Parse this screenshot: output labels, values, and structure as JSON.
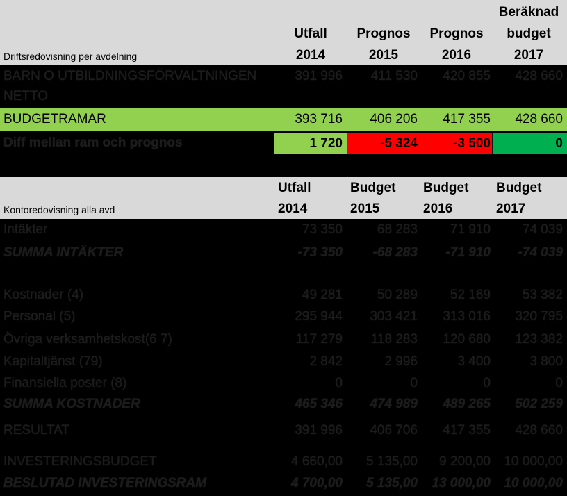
{
  "section1": {
    "caption": "Driftsredovisning per avdelning",
    "headers": [
      {
        "line1": "",
        "line2": "Utfall",
        "line3": "2014"
      },
      {
        "line1": "",
        "line2": "Prognos",
        "line3": "2015"
      },
      {
        "line1": "",
        "line2": "Prognos",
        "line3": "2016"
      },
      {
        "line1": "Beräknad",
        "line2": "budget",
        "line3": "2017"
      }
    ],
    "net_row": {
      "label_line1": "BARN O UTBILDNINGSFÖRVALTNINGEN",
      "label_line2": "NETTO",
      "values": [
        "391 996",
        "411 530",
        "420 855",
        "428 660"
      ]
    },
    "budget_row": {
      "label": "BUDGETRAMAR",
      "values": [
        "393 716",
        "406 206",
        "417 355",
        "428 660"
      ]
    },
    "diff_row": {
      "label": "Diff mellan ram och prognos",
      "values": [
        "1 720",
        "-5 324",
        "-3 500",
        "0"
      ]
    }
  },
  "section2": {
    "caption": "Kontoredovisning alla avd",
    "headers": [
      {
        "line1": "Utfall",
        "line2": "2014"
      },
      {
        "line1": "Budget",
        "line2": "2015"
      },
      {
        "line1": "Budget",
        "line2": "2016"
      },
      {
        "line1": "Budget",
        "line2": "2017"
      }
    ],
    "rows": [
      {
        "label": "Intäkter",
        "values": [
          "73 350",
          "68 283",
          "71 910",
          "74 039"
        ]
      },
      {
        "label": "SUMMA INTÄKTER",
        "values": [
          "-73 350",
          "-68 283",
          "-71 910",
          "-74 039"
        ]
      },
      {
        "label": "Kostnader (4)",
        "values": [
          "49 281",
          "50 289",
          "52 169",
          "53 382"
        ]
      },
      {
        "label": "Personal (5)",
        "values": [
          "295 944",
          "303 421",
          "313 016",
          "320 795"
        ]
      },
      {
        "label": "Övriga verksamhetskost(6 7)",
        "values": [
          "117 279",
          "118 283",
          "120 680",
          "123 382"
        ]
      },
      {
        "label": "Kapitaltjänst (79)",
        "values": [
          "2 842",
          "2 996",
          "3 400",
          "3 800"
        ]
      },
      {
        "label": "Finansiella poster (8)",
        "values": [
          "0",
          "0",
          "0",
          "0"
        ]
      },
      {
        "label": "SUMMA KOSTNADER",
        "values": [
          "465 346",
          "474 989",
          "489 265",
          "502 259"
        ]
      },
      {
        "label": "RESULTAT",
        "values": [
          "391 996",
          "406 706",
          "417 355",
          "428 660"
        ]
      },
      {
        "label": "INVESTERINGSBUDGET",
        "values": [
          "4 660,00",
          "5 135,00",
          "9 200,00",
          "10 000,00"
        ]
      },
      {
        "label": "BESLUTAD INVESTERINGSRAM",
        "values": [
          "4 700,00",
          "5 135,00",
          "13 000,00",
          "10 000,00"
        ]
      }
    ]
  },
  "colors": {
    "header_bg": "#d9d9d9",
    "green": "#92d050",
    "bright_green": "#00b050",
    "red": "#ff0000",
    "black": "#000000"
  }
}
